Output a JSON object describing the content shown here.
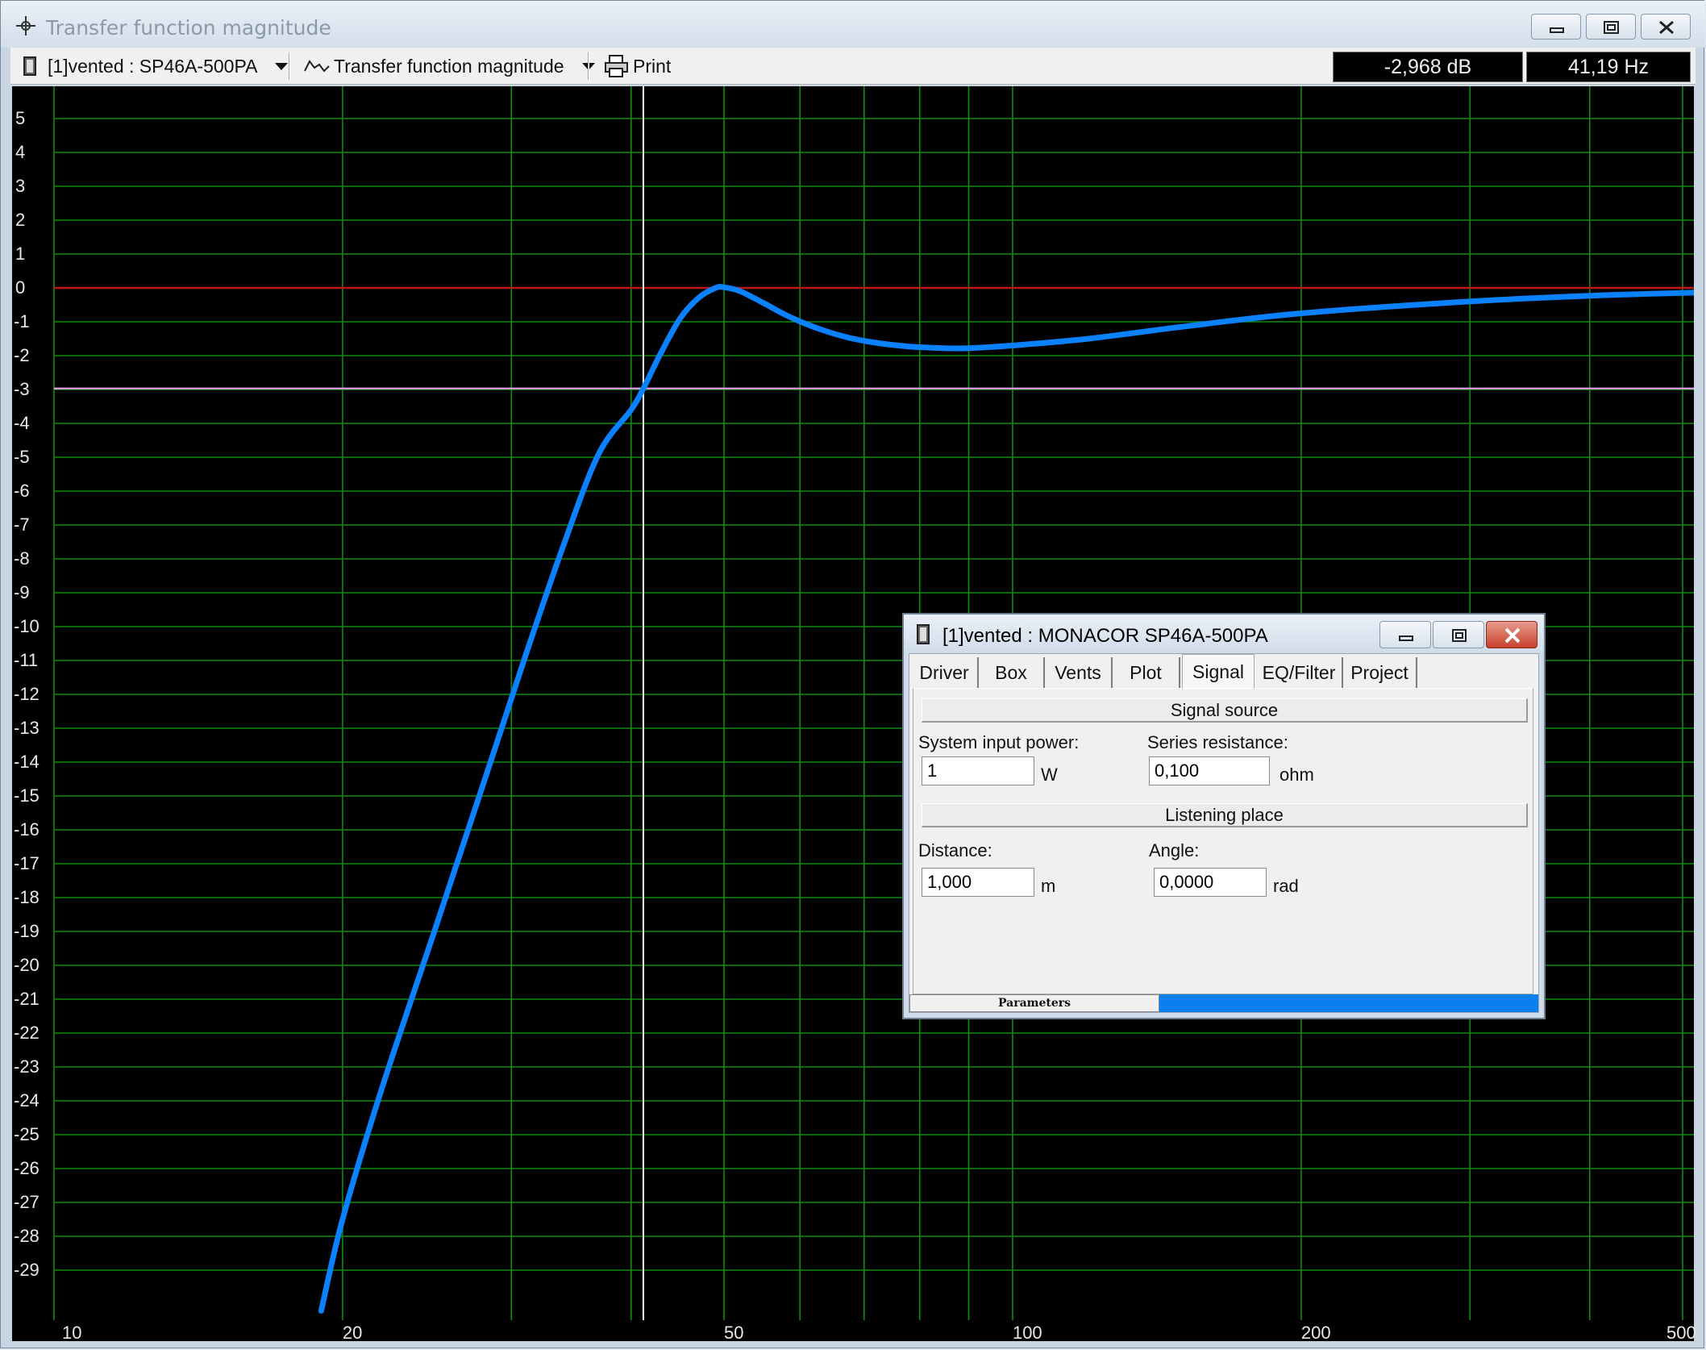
{
  "window": {
    "title": "Transfer function magnitude",
    "buttons": [
      "minimize",
      "restore",
      "close"
    ]
  },
  "toolbar": {
    "project_selector": "[1]vented : SP46A-500PA",
    "plot_selector": "Transfer function magnitude",
    "print_label": "Print",
    "readout_db": "-2,968 dB",
    "readout_hz": "41,19 Hz"
  },
  "chart_data": {
    "type": "line",
    "x_scale": "log",
    "xlim": [
      9.5,
      530
    ],
    "ylim": [
      -30.5,
      6
    ],
    "x_ticks": [
      10,
      20,
      50,
      100,
      200,
      500
    ],
    "x_tick_labels": [
      "10",
      "20",
      "50",
      "100",
      "200",
      "500"
    ],
    "x_grid": [
      10,
      20,
      30,
      40,
      50,
      60,
      70,
      80,
      90,
      100,
      200,
      300,
      400,
      500
    ],
    "y_ticks": [
      5,
      4,
      3,
      2,
      1,
      0,
      -1,
      -2,
      -3,
      -4,
      -5,
      -6,
      -7,
      -8,
      -9,
      -10,
      -11,
      -12,
      -13,
      -14,
      -15,
      -16,
      -17,
      -18,
      -19,
      -20,
      -21,
      -22,
      -23,
      -24,
      -25,
      -26,
      -27,
      -28,
      -29
    ],
    "grid": true,
    "reference_line_db": 0,
    "reference_color": "#c0151b",
    "cursor": {
      "x": 41.19,
      "y": -2.968,
      "color": "#ffffff",
      "hline_color": "#ff9fff"
    },
    "series": [
      {
        "color": "#0a82ff",
        "x": [
          19.0,
          20.0,
          22.0,
          25.0,
          28.0,
          31.0,
          34.0,
          37.0,
          40.0,
          41.19,
          43.0,
          45.0,
          47.0,
          49.0,
          50.0,
          52.0,
          55.0,
          58.0,
          62.0,
          67.0,
          72.0,
          78.0,
          85.0,
          90.0,
          100.0,
          120.0,
          150.0,
          200.0,
          300.0,
          400.0,
          500.0,
          530.0
        ],
        "y": [
          -30.2,
          -27.5,
          -23.6,
          -18.9,
          -14.7,
          -10.9,
          -7.6,
          -4.9,
          -3.6,
          -2.97,
          -1.9,
          -0.9,
          -0.3,
          0.0,
          0.02,
          -0.1,
          -0.45,
          -0.8,
          -1.15,
          -1.45,
          -1.62,
          -1.73,
          -1.78,
          -1.78,
          -1.7,
          -1.5,
          -1.15,
          -0.75,
          -0.4,
          -0.23,
          -0.15,
          -0.13
        ]
      }
    ]
  },
  "dialog": {
    "title": "[1]vented : MONACOR SP46A-500PA",
    "tabs": [
      "Driver",
      "Box",
      "Vents",
      "Plot",
      "Signal",
      "EQ/Filter",
      "Project"
    ],
    "active_tab": "Signal",
    "signal_source_header": "Signal source",
    "input_power_label": "System input power:",
    "input_power_value": "1",
    "input_power_unit": "W",
    "series_resistance_label": "Series resistance:",
    "series_resistance_value": "0,100",
    "series_resistance_unit": "ohm",
    "listening_place_header": "Listening place",
    "distance_label": "Distance:",
    "distance_value": "1,000",
    "distance_unit": "m",
    "angle_label": "Angle:",
    "angle_value": "0,0000",
    "angle_unit": "rad",
    "status_left": "Parameters"
  }
}
